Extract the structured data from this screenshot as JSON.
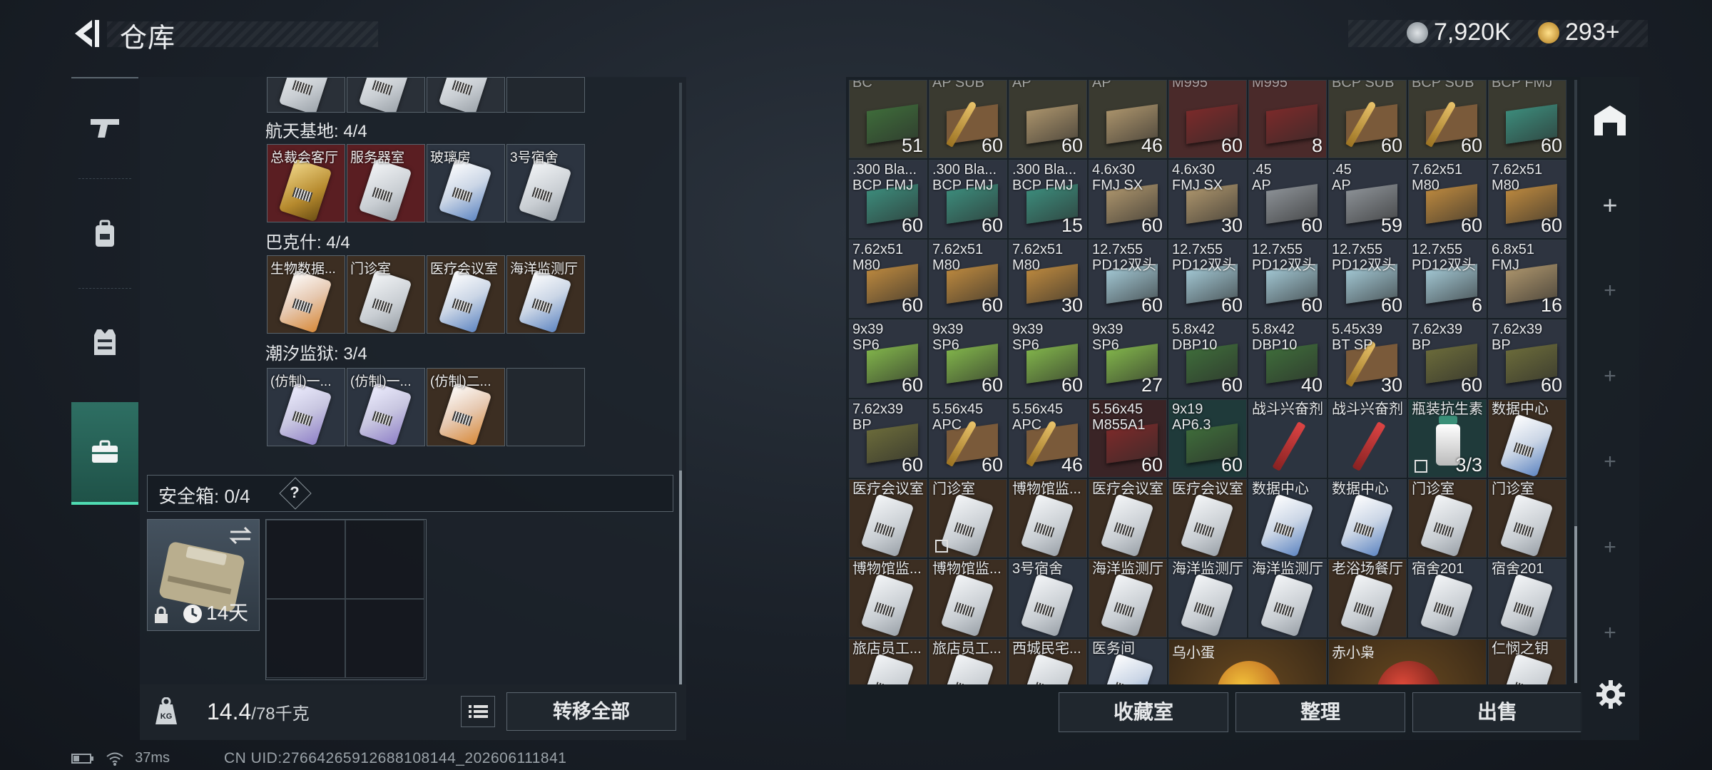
{
  "header": {
    "title": "仓库",
    "currency_1": "7,920K",
    "currency_2": "293+",
    "back_icon": "back-arrow-icon"
  },
  "left_nav": {
    "items": [
      {
        "icon": "pistol-icon"
      },
      {
        "icon": "backpack-icon"
      },
      {
        "icon": "vest-icon"
      },
      {
        "icon": "briefcase-icon",
        "active": true
      }
    ]
  },
  "keycard_groups": [
    {
      "title": "航天基地: 4/4",
      "cells": [
        "总裁会客厅",
        "服务器室",
        "玻璃房",
        "3号宿舍"
      ]
    },
    {
      "title": "巴克什: 4/4",
      "cells": [
        "生物数据...",
        "门诊室",
        "医疗会议室",
        "海洋监测厅"
      ]
    },
    {
      "title": "潮汐监狱: 3/4",
      "cells": [
        "(仿制)一...",
        "(仿制)一...",
        "(仿制)二...",
        ""
      ]
    }
  ],
  "safebox": {
    "label": "安全箱: 0/4",
    "help": "?",
    "duration": "14天"
  },
  "weight": {
    "current": "14.4",
    "max": "/78千克",
    "transfer_all": "转移全部"
  },
  "items_rows": [
    [
      {
        "name": "BC",
        "count": "51",
        "kind": "box-green"
      },
      {
        "name": "AP SUB",
        "count": "60",
        "kind": "bullet"
      },
      {
        "name": "AP",
        "count": "60",
        "kind": "box-tan"
      },
      {
        "name": "AP",
        "count": "46",
        "kind": "box-tan"
      },
      {
        "name": "M995",
        "count": "60",
        "kind": "box-red"
      },
      {
        "name": "M995",
        "count": "8",
        "kind": "box-red"
      },
      {
        "name": "BCP SUB",
        "count": "60",
        "kind": "bullet"
      },
      {
        "name": "BCP SUB",
        "count": "60",
        "kind": "bullet"
      },
      {
        "name": "BCP FMJ",
        "count": "60",
        "kind": "box-teal"
      }
    ],
    [
      {
        "name": ".300 Bla...\nBCP FMJ",
        "count": "60",
        "kind": "box-teal"
      },
      {
        "name": ".300 Bla...\nBCP FMJ",
        "count": "60",
        "kind": "box-teal"
      },
      {
        "name": ".300 Bla...\nBCP FMJ",
        "count": "15",
        "kind": "box-teal"
      },
      {
        "name": "4.6x30\nFMJ SX",
        "count": "60",
        "kind": "box-tan"
      },
      {
        "name": "4.6x30\nFMJ SX",
        "count": "30",
        "kind": "box-tan"
      },
      {
        "name": ".45\nAP",
        "count": "60",
        "kind": "box-grey"
      },
      {
        "name": ".45\nAP",
        "count": "59",
        "kind": "box-grey"
      },
      {
        "name": "7.62x51\nM80",
        "count": "60",
        "kind": "box-cardboard"
      },
      {
        "name": "7.62x51\nM80",
        "count": "60",
        "kind": "box-cardboard"
      }
    ],
    [
      {
        "name": "7.62x51\nM80",
        "count": "60",
        "kind": "box-cardboard"
      },
      {
        "name": "7.62x51\nM80",
        "count": "60",
        "kind": "box-cardboard"
      },
      {
        "name": "7.62x51\nM80",
        "count": "30",
        "kind": "box-cardboard"
      },
      {
        "name": "12.7x55\nPD12双头",
        "count": "60",
        "kind": "box-ice"
      },
      {
        "name": "12.7x55\nPD12双头",
        "count": "60",
        "kind": "box-ice"
      },
      {
        "name": "12.7x55\nPD12双头",
        "count": "60",
        "kind": "box-ice"
      },
      {
        "name": "12.7x55\nPD12双头",
        "count": "60",
        "kind": "box-ice"
      },
      {
        "name": "12.7x55\nPD12双头",
        "count": "6",
        "kind": "box-ice"
      },
      {
        "name": "6.8x51\nFMJ",
        "count": "16",
        "kind": "box-tan"
      }
    ],
    [
      {
        "name": "9x39\nSP6",
        "count": "60",
        "kind": "box-lime"
      },
      {
        "name": "9x39\nSP6",
        "count": "60",
        "kind": "box-lime"
      },
      {
        "name": "9x39\nSP6",
        "count": "60",
        "kind": "box-lime"
      },
      {
        "name": "9x39\nSP6",
        "count": "27",
        "kind": "box-lime"
      },
      {
        "name": "5.8x42\nDBP10",
        "count": "60",
        "kind": "box-green"
      },
      {
        "name": "5.8x42\nDBP10",
        "count": "40",
        "kind": "box-green"
      },
      {
        "name": "5.45x39\nBT SP",
        "count": "30",
        "kind": "bullet"
      },
      {
        "name": "7.62x39\nBP",
        "count": "60",
        "kind": "box-olive"
      },
      {
        "name": "7.62x39\nBP",
        "count": "60",
        "kind": "box-olive"
      }
    ],
    [
      {
        "name": "7.62x39\nBP",
        "count": "60",
        "kind": "box-olive"
      },
      {
        "name": "5.56x45\nAPC",
        "count": "60",
        "kind": "bullet"
      },
      {
        "name": "5.56x45\nAPC",
        "count": "46",
        "kind": "bullet"
      },
      {
        "name": "5.56x45\nM855A1",
        "count": "60",
        "kind": "box-red"
      },
      {
        "name": "9x19\nAP6.3",
        "count": "60",
        "kind": "box-green",
        "bg": "teal"
      },
      {
        "name": "战斗兴奋剂",
        "count": "",
        "kind": "syringe",
        "bg": "slate"
      },
      {
        "name": "战斗兴奋剂",
        "count": "",
        "kind": "syringe",
        "bg": "slate"
      },
      {
        "name": "瓶装抗生素",
        "count": "3/3",
        "kind": "bottle",
        "bg": "teal",
        "icon": true
      },
      {
        "name": "数据中心",
        "count": "",
        "kind": "card",
        "bg": "brown",
        "card": "stripe-blue"
      }
    ],
    [
      {
        "name": "医疗会议室",
        "count": "",
        "kind": "card",
        "bg": "brown"
      },
      {
        "name": "门诊室",
        "count": "",
        "kind": "card",
        "bg": "brown",
        "icon": true
      },
      {
        "name": "博物馆监...",
        "count": "",
        "kind": "card",
        "bg": "brown"
      },
      {
        "name": "医疗会议室",
        "count": "",
        "kind": "card",
        "bg": "brown"
      },
      {
        "name": "医疗会议室",
        "count": "",
        "kind": "card",
        "bg": "brown"
      },
      {
        "name": "数据中心",
        "count": "",
        "kind": "card",
        "bg": "slate",
        "card": "stripe-blue"
      },
      {
        "name": "数据中心",
        "count": "",
        "kind": "card",
        "bg": "slate",
        "card": "stripe-blue"
      },
      {
        "name": "门诊室",
        "count": "",
        "kind": "card",
        "bg": "brown"
      },
      {
        "name": "门诊室",
        "count": "",
        "kind": "card",
        "bg": "brown"
      }
    ],
    [
      {
        "name": "博物馆监...",
        "count": "",
        "kind": "card",
        "bg": "brown"
      },
      {
        "name": "博物馆监...",
        "count": "",
        "kind": "card",
        "bg": "brown"
      },
      {
        "name": "3号宿舍",
        "count": "",
        "kind": "card",
        "bg": "slate"
      },
      {
        "name": "海洋监测厅",
        "count": "",
        "kind": "card",
        "bg": "brown"
      },
      {
        "name": "海洋监测厅",
        "count": "",
        "kind": "card",
        "bg": "slate"
      },
      {
        "name": "海洋监测厅",
        "count": "",
        "kind": "card",
        "bg": "slate"
      },
      {
        "name": "老浴场餐厅",
        "count": "",
        "kind": "card",
        "bg": "brown"
      },
      {
        "name": "宿舍201",
        "count": "",
        "kind": "card",
        "bg": "slate"
      },
      {
        "name": "宿舍201",
        "count": "",
        "kind": "card",
        "bg": "slate"
      }
    ]
  ],
  "items_last_row": [
    {
      "name": "旅店员工...",
      "kind": "card",
      "bg": "brown"
    },
    {
      "name": "旅店员工...",
      "kind": "card",
      "bg": "brown"
    },
    {
      "name": "西城民宅...",
      "kind": "card",
      "bg": "brown"
    },
    {
      "name": "医务间",
      "kind": "card",
      "bg": "slate",
      "card": "stripe-blue"
    },
    {
      "name": "乌小蛋",
      "kind": "big"
    },
    {
      "name": "赤小枭",
      "kind": "big"
    },
    {
      "name": "仁悯之钥",
      "kind": "card",
      "bg": "brown"
    }
  ],
  "bottom_buttons": {
    "collection": "收藏室",
    "organize": "整理",
    "sell": "出售"
  },
  "right_side": {
    "top_icon": "warehouse-icon",
    "plus": "+",
    "settings_icon": "gear-icon"
  },
  "status": {
    "ping": "37ms",
    "uid": "CN UID:276642659126881081​44_202606111841"
  },
  "colors": {
    "accent": "#4fdcb2",
    "bg_brown": "#3c2e22",
    "bg_slate": "#2c3440",
    "bg_teal": "#1f3a3a",
    "bg_red": "#5a1e22"
  }
}
